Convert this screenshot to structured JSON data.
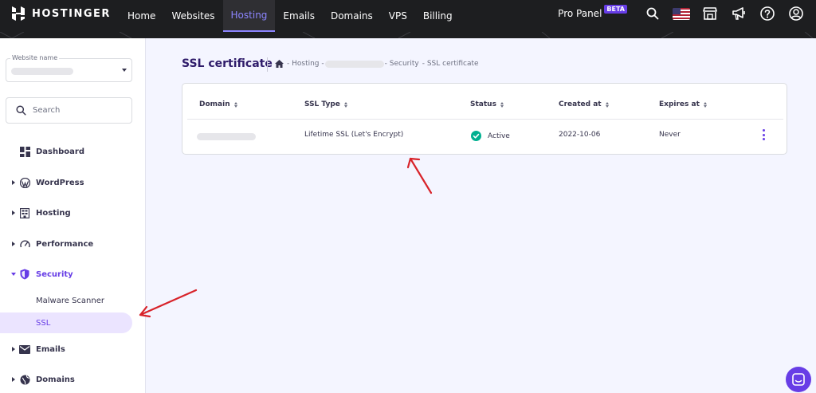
{
  "brand": {
    "name": "HOSTINGER"
  },
  "nav": {
    "items": [
      {
        "label": "Home"
      },
      {
        "label": "Websites"
      },
      {
        "label": "Hosting"
      },
      {
        "label": "Emails"
      },
      {
        "label": "Domains"
      },
      {
        "label": "VPS"
      },
      {
        "label": "Billing"
      }
    ],
    "active": "Hosting"
  },
  "topbar": {
    "pro_panel": "Pro Panel",
    "beta_badge": "BETA",
    "icons": [
      "search-icon",
      "us-flag-icon",
      "store-icon",
      "megaphone-icon",
      "help-icon",
      "account-icon"
    ]
  },
  "sidebar": {
    "website_label": "Website name",
    "search_placeholder": "Search",
    "items": [
      {
        "label": "Dashboard",
        "icon": "dashboard-icon"
      },
      {
        "label": "WordPress",
        "icon": "wordpress-icon"
      },
      {
        "label": "Hosting",
        "icon": "hosting-icon"
      },
      {
        "label": "Performance",
        "icon": "performance-icon"
      },
      {
        "label": "Security",
        "icon": "shield-icon",
        "expanded": true
      },
      {
        "label": "Emails",
        "icon": "mail-icon"
      },
      {
        "label": "Domains",
        "icon": "globe-icon"
      }
    ],
    "security_sub": [
      {
        "label": "Malware Scanner"
      },
      {
        "label": "SSL",
        "active": true
      }
    ]
  },
  "page": {
    "title": "SSL certificate",
    "breadcrumb": {
      "hosting": "- Hosting -",
      "security": "- Security",
      "current": "- SSL certificate"
    }
  },
  "table": {
    "columns": [
      "Domain",
      "SSL Type",
      "Status",
      "Created at",
      "Expires at"
    ],
    "rows": [
      {
        "domain": "",
        "ssl_type": "Lifetime SSL (Let's Encrypt)",
        "status": "Active",
        "created_at": "2022-10-06",
        "expires_at": "Never"
      }
    ]
  },
  "colors": {
    "accent": "#673de6",
    "topbar": "#1d1e20",
    "active_nav_text": "#8c85ff",
    "status_active": "#00b090",
    "annotation_arrow": "#d8232a"
  }
}
